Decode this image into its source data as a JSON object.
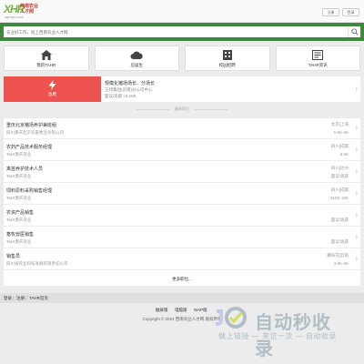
{
  "header": {
    "logo_mark": "XHR",
    "logo_name": "西南农业人才网",
    "logo_url": "agri.xhrc.com",
    "register_label": "注册",
    "login_label": "登录"
  },
  "search": {
    "placeholder": "农业好工作，就上西南农业人才网"
  },
  "nav": [
    {
      "label": "我的TAHR",
      "icon": "home-icon"
    },
    {
      "label": "应届生",
      "icon": "cloud-icon"
    },
    {
      "label": "校园招聘",
      "icon": "building-icon"
    },
    {
      "label": "TAHR资讯",
      "icon": "news-icon"
    }
  ],
  "promo": {
    "tile_label": "急聘",
    "icon": "lightning-icon",
    "title": "规模化猪场场长、分场长",
    "line1": "正邦集团(云南)分公司中心",
    "line2": "面议/高薪 | ¥ 15K"
  },
  "section_label": "最新职位",
  "jobs": [
    {
      "title": "重庆北京猪场养护兼班组",
      "company": "四川重庆北京农畜牧业有限公司",
      "location": "北京|上海",
      "salary": "6-8K·6K"
    },
    {
      "title": "农药产品技术服务经理",
      "company": "TaHr重庆农业",
      "location": "四川|成都",
      "salary": "8.5K"
    },
    {
      "title": "禽苗养护技术人员",
      "company": "TaHr重庆农业",
      "location": "四川|达州",
      "salary": "面议/高薪"
    },
    {
      "title": "饲料原料采购销售经理",
      "company": "TaHr重庆农业",
      "location": "四川|成都",
      "salary": "¥10K-15K"
    },
    {
      "title": "农资产品销售",
      "company": "TaHr重庆农业",
      "location": "",
      "salary": "面议/高薪"
    },
    {
      "title": "畜牧兽医销售",
      "company": "TaHr重庆农业",
      "location": "",
      "salary": "面议/高薪"
    },
    {
      "title": "销售员",
      "company": "四川省农业科技发展有限责任公司",
      "location": "攀枝花|云南",
      "salary": "4-6K·6K"
    }
  ],
  "more_label": "更多职位...",
  "bottom_nav": [
    "登录",
    "注册",
    "TAHR首页"
  ],
  "footer": {
    "links": [
      "触屏版",
      "电脑版",
      "WAP版"
    ],
    "copyright": "Copyright © 2024 西南农业人才网 版权所有"
  },
  "watermark": {
    "title": "自动秒收录",
    "subtitle": "做上链接 — 来访一次 — 自动收录"
  }
}
